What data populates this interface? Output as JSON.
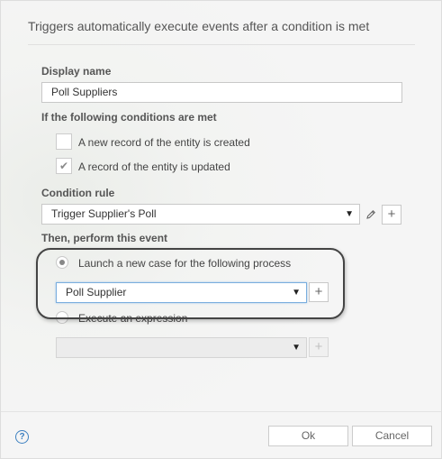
{
  "dialog": {
    "header": "Triggers automatically execute events after a condition is met"
  },
  "display_name": {
    "label": "Display name",
    "value": "Poll Suppliers"
  },
  "conditions": {
    "label": "If the following conditions are met",
    "options": [
      {
        "label": "A new record of the entity is created",
        "checked": false
      },
      {
        "label": "A record of the entity is updated",
        "checked": true
      }
    ]
  },
  "condition_rule": {
    "label": "Condition rule",
    "selected": "Trigger Supplier's Poll",
    "edit_icon": "pencil-icon",
    "add_icon": "plus-icon"
  },
  "event": {
    "label": "Then, perform this event",
    "launch_case": {
      "label": "Launch a new case for the following process",
      "selected": true,
      "process_selected": "Poll Supplier"
    },
    "expression": {
      "label": "Execute an expression",
      "selected": false,
      "value": ""
    }
  },
  "footer": {
    "help_icon": "help-icon",
    "help_glyph": "?",
    "ok_label": "Ok",
    "cancel_label": "Cancel"
  },
  "colors": {
    "accent": "#3d80c0",
    "focus_border": "#7aaede",
    "highlight_ring": "#444444"
  }
}
